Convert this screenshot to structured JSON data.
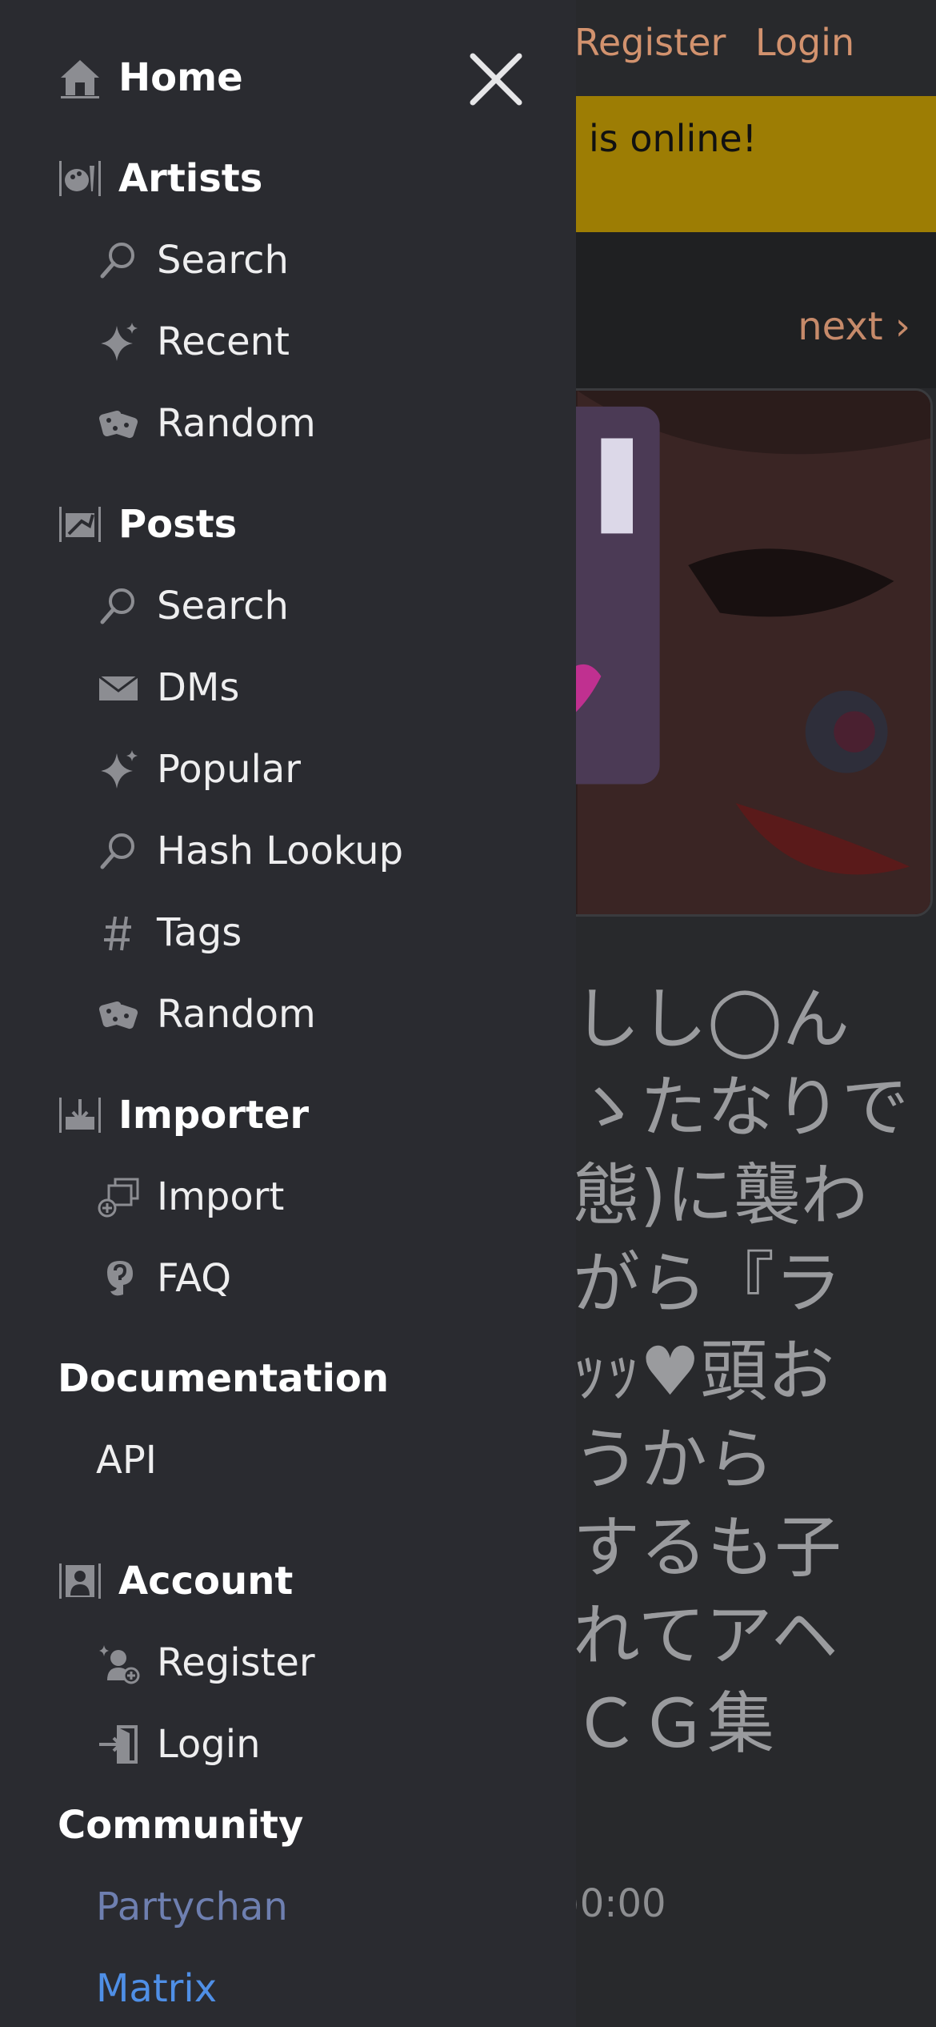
{
  "background": {
    "header": {
      "register_label": "Register",
      "login_label": "Login"
    },
    "banner": {
      "text": "is online!"
    },
    "pager": {
      "next_label": "next ›"
    },
    "post_title_fragment": "しし◯ん\nゝたなりで\n態)に襲わ\nがら『ラ\nｯｯ♥頭お\nうから\nするも子\nれてアヘ\nＣＧ集",
    "post_time_fragment": ")0:00"
  },
  "menu": {
    "close_icon": "close-icon",
    "home": {
      "label": "Home",
      "icon": "home-icon"
    },
    "artists": {
      "label": "Artists",
      "icon": "artists-icon",
      "items": [
        {
          "label": "Search",
          "icon": "search-icon"
        },
        {
          "label": "Recent",
          "icon": "sparkle-icon"
        },
        {
          "label": "Random",
          "icon": "dice-icon"
        }
      ]
    },
    "posts": {
      "label": "Posts",
      "icon": "posts-icon",
      "items": [
        {
          "label": "Search",
          "icon": "search-icon"
        },
        {
          "label": "DMs",
          "icon": "envelope-icon"
        },
        {
          "label": "Popular",
          "icon": "sparkle-icon"
        },
        {
          "label": "Hash Lookup",
          "icon": "search-icon"
        },
        {
          "label": "Tags",
          "icon": "hash-icon"
        },
        {
          "label": "Random",
          "icon": "dice-icon"
        }
      ]
    },
    "importer": {
      "label": "Importer",
      "icon": "importer-icon",
      "items": [
        {
          "label": "Import",
          "icon": "import-icon"
        },
        {
          "label": "FAQ",
          "icon": "faq-icon"
        }
      ]
    },
    "documentation": {
      "label": "Documentation",
      "items": [
        {
          "label": "API"
        }
      ]
    },
    "account": {
      "label": "Account",
      "icon": "account-icon",
      "items": [
        {
          "label": "Register",
          "icon": "register-icon"
        },
        {
          "label": "Login",
          "icon": "login-icon"
        }
      ]
    },
    "community": {
      "label": "Community",
      "links": [
        {
          "label": "Partychan"
        },
        {
          "label": "Matrix"
        }
      ]
    }
  },
  "colors": {
    "sidebar_bg": "#2a2b30",
    "banner_bg": "#9d7d04",
    "accent_link": "#d2926e",
    "partychan_link": "#6e7fb0",
    "matrix_link": "#4f8fe6",
    "icon_gray": "#8c8d92"
  }
}
